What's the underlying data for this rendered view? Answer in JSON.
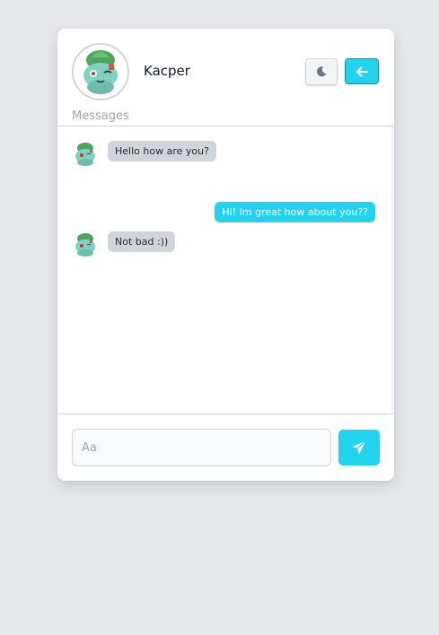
{
  "header": {
    "username": "Kacper",
    "avatar_icon": "bulbasaur-avatar-icon",
    "theme_toggle_icon": "moon-icon",
    "back_icon": "arrow-left-icon"
  },
  "section_label": "Messages",
  "messages": [
    {
      "direction": "incoming",
      "text": "Hello how are you?"
    },
    {
      "direction": "outgoing",
      "text": "Hi! Im great how about you??"
    },
    {
      "direction": "incoming",
      "text": "Not bad :))"
    }
  ],
  "composer": {
    "placeholder": "Aa",
    "value": "",
    "send_icon": "paper-plane-icon"
  },
  "colors": {
    "page_background": "#e5e7eb",
    "accent": "#22d3ee",
    "incoming_bubble": "#d1d5db",
    "muted_text": "#9ca3af"
  }
}
